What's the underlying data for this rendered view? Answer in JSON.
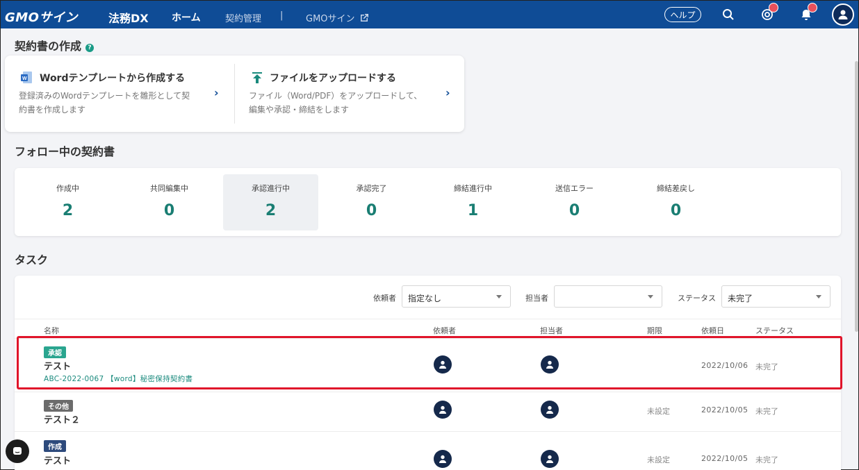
{
  "header": {
    "logo": "GMOサイン",
    "logo_sub": "法務DX",
    "nav_home": "ホーム",
    "nav_contracts": "契約管理",
    "nav_separator": "|",
    "nav_gmo": "GMOサイン",
    "help": "ヘルプ",
    "brand_color": "#0f4c96",
    "icons": [
      "search-icon",
      "mention-icon",
      "bell-icon",
      "user-avatar-icon"
    ]
  },
  "create": {
    "title": "契約書の作成",
    "word": {
      "title": "Wordテンプレートから作成する",
      "desc1": "登録済みのWordテンプレートを雛形として契",
      "desc2": "約書を作成します"
    },
    "upload": {
      "title": "ファイルをアップロードする",
      "desc1": "ファイル（Word/PDF）をアップロードして、",
      "desc2": "編集や承認・締結をします"
    }
  },
  "follow": {
    "title": "フォロー中の契約書",
    "stats": [
      {
        "label": "作成中",
        "value": "2"
      },
      {
        "label": "共同編集中",
        "value": "0"
      },
      {
        "label": "承認進行中",
        "value": "2"
      },
      {
        "label": "承認完了",
        "value": "0"
      },
      {
        "label": "締結進行中",
        "value": "1"
      },
      {
        "label": "送信エラー",
        "value": "0"
      },
      {
        "label": "締結差戻し",
        "value": "0"
      }
    ],
    "active_index": 2,
    "value_color": "#1a7e73"
  },
  "tasks": {
    "title": "タスク",
    "filters": {
      "requester_label": "依頼者",
      "requester_value": "指定なし",
      "assignee_label": "担当者",
      "assignee_value": "",
      "status_label": "ステータス",
      "status_value": "未完了"
    },
    "columns": {
      "name": "名称",
      "requester": "依頼者",
      "assignee": "担当者",
      "due": "期限",
      "requested": "依頼日",
      "status": "ステータス"
    },
    "rows": [
      {
        "tag": "承認",
        "tag_color": "#2aa58f",
        "title": "テスト",
        "sub": "ABC-2022-0067 【word】秘密保持契約書",
        "due": "",
        "date": "2022/10/06",
        "status": "未完了"
      },
      {
        "tag": "その他",
        "tag_color": "#6b6b6b",
        "title": "テスト２",
        "sub": "",
        "due": "未設定",
        "date": "2022/10/05",
        "status": "未完了"
      },
      {
        "tag": "作成",
        "tag_color": "#2d4a7c",
        "title": "テスト",
        "sub": "",
        "due": "未設定",
        "date": "2022/10/05",
        "status": "未完了"
      }
    ]
  }
}
